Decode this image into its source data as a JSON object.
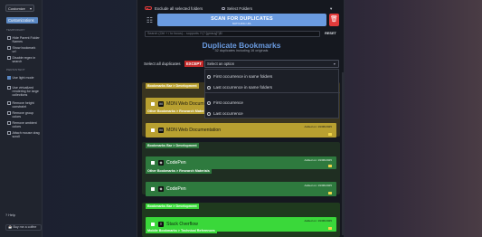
{
  "sidebar": {
    "dropdown": "Customize",
    "selected": "Customizations",
    "temporary_heading": "TEMPORARY",
    "temporary_options": [
      {
        "label": "Hide Parent Folder Names",
        "checked": false
      },
      {
        "label": "Show bookmark url",
        "checked": false
      },
      {
        "label": "Disable regex in search",
        "checked": false
      }
    ],
    "persistent_heading": "PERSISTENT",
    "persistent_options": [
      {
        "label": "Use light mode",
        "checked": true
      },
      {
        "label": "Use virtualized rendering for large collections",
        "checked": false
      },
      {
        "label": "Remove height constraint",
        "checked": false
      },
      {
        "label": "Remove group colors",
        "checked": false
      },
      {
        "label": "Remove ambient colors",
        "checked": false
      },
      {
        "label": "Attach mouse drag scroll",
        "checked": false
      }
    ],
    "help": "Help",
    "coffee": "Buy me a coffee"
  },
  "top": {
    "exclude_label": "Exclude all selected folders",
    "select_folders": "Select Folders"
  },
  "scan": {
    "title": "SCAN FOR DUPLICATES",
    "subtitle": "MATCHING URL"
  },
  "search": {
    "placeholder": "Search (Ctrl + / to focus)... supports /^(?:[gmsuy]*)$/",
    "reset": "RESET"
  },
  "heading": {
    "title": "Duplicate Bookmarks",
    "subtitle": "32 duplicates including 16 originals"
  },
  "select_all": {
    "label": "Select all duplicates",
    "except": "EXCEPT",
    "dropdown": "Select an option"
  },
  "menu": {
    "items": [
      "First occurrence in same folders",
      "Last occurrence in same folders",
      "First occurrence",
      "Last occurrence"
    ]
  },
  "groups": [
    {
      "accent": "#b8a030",
      "bg": "#3a3520",
      "cards": [
        {
          "folder": "Bookmarks Bar > Development",
          "title": "MDN Web Documentation",
          "date": "Added on: 19/06/2025",
          "icon": "M"
        },
        {
          "folder": "Other Bookmarks > Research Materials",
          "title": "MDN Web Documentation",
          "date": "Added on: 19/06/2025",
          "icon": "M"
        }
      ]
    },
    {
      "accent": "#2e7a3e",
      "bg": "#1f2e22",
      "cards": [
        {
          "folder": "Bookmarks Bar > Development",
          "title": "CodePen",
          "date": "Added on: 19/06/2025",
          "icon": "◈"
        },
        {
          "folder": "Other Bookmarks > Research Materials",
          "title": "CodePen",
          "date": "Added on: 19/06/2025",
          "icon": "◈"
        }
      ]
    },
    {
      "accent": "#3ad83a",
      "bg": "#1f3a1e",
      "cards": [
        {
          "folder": "Bookmarks Bar > Development",
          "title": "Stack Overflow",
          "date": "Added on: 19/06/2025",
          "icon": "≡"
        },
        {
          "folder": "Mobile Bookmarks > Technical References",
          "title": "",
          "date": "",
          "icon": ""
        }
      ]
    }
  ]
}
